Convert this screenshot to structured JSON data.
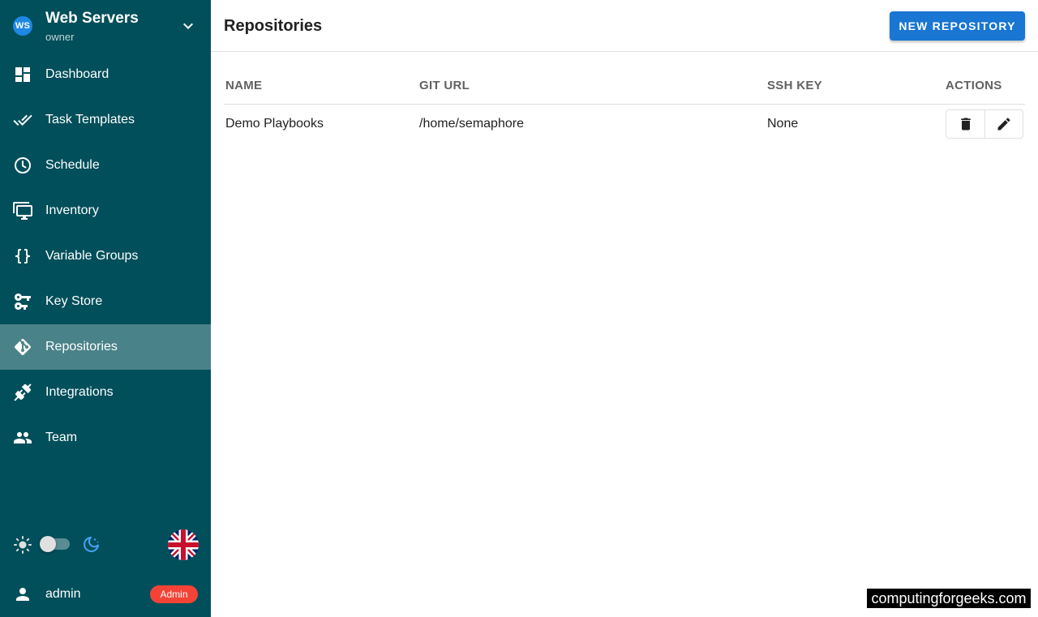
{
  "project": {
    "initials": "WS",
    "name": "Web Servers",
    "role": "owner"
  },
  "nav": [
    {
      "label": "Dashboard",
      "icon": "dashboard-icon"
    },
    {
      "label": "Task Templates",
      "icon": "done-all-icon"
    },
    {
      "label": "Schedule",
      "icon": "clock-icon"
    },
    {
      "label": "Inventory",
      "icon": "monitor-multiple-icon"
    },
    {
      "label": "Variable Groups",
      "icon": "code-braces-icon"
    },
    {
      "label": "Key Store",
      "icon": "key-change-icon"
    },
    {
      "label": "Repositories",
      "icon": "git-icon",
      "active": true
    },
    {
      "label": "Integrations",
      "icon": "connection-icon"
    },
    {
      "label": "Team",
      "icon": "account-multiple-icon"
    }
  ],
  "theme": {
    "dark_mode": false
  },
  "language": {
    "flag": "uk-flag-icon"
  },
  "user": {
    "name": "admin",
    "badge": "Admin"
  },
  "page": {
    "title": "Repositories",
    "new_button": "NEW REPOSITORY"
  },
  "table": {
    "headers": {
      "name": "NAME",
      "git_url": "GIT URL",
      "ssh_key": "SSH KEY",
      "actions": "ACTIONS"
    },
    "rows": [
      {
        "name": "Demo Playbooks",
        "git_url": "/home/semaphore",
        "ssh_key": "None"
      }
    ]
  },
  "watermark": "computingforgeeks.com",
  "colors": {
    "sidebar": "#004f5a",
    "sidebar_active": "#4a8289",
    "primary": "#1976d2",
    "badge": "#f44336",
    "avatar": "#1e88e5"
  }
}
